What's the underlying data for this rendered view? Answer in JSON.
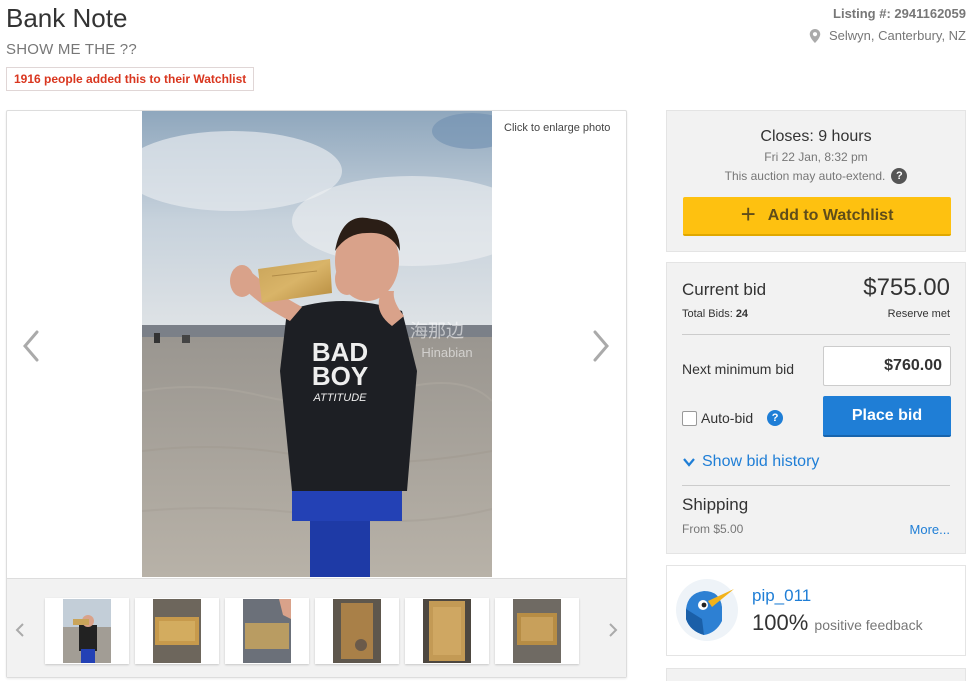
{
  "listing": {
    "title": "Bank Note",
    "subtitle": "SHOW ME THE ??",
    "watchlist_banner": "1916 people added this to their Watchlist",
    "listing_number": "Listing #: 2941162059",
    "location": "Selwyn, Canterbury, NZ"
  },
  "gallery": {
    "enlarge_hint": "Click to enlarge photo",
    "watermark_cn": "海那边",
    "watermark_en": "Hinabian",
    "shirt_line1": "BAD",
    "shirt_line2": "BOY",
    "shirt_line3": "ATTITUDE",
    "thumbnail_count": 6
  },
  "auction": {
    "closes": "Closes: 9 hours",
    "closes_date": "Fri 22 Jan, 8:32 pm",
    "auto_extend": "This auction may auto-extend.",
    "help_glyph": "?",
    "add_watchlist": "Add to Watchlist",
    "plus_glyph": "+"
  },
  "bid": {
    "current_label": "Current bid",
    "current_amount": "$755.00",
    "total_bids_label": "Total Bids:",
    "total_bids_count": "24",
    "reserve": "Reserve met",
    "next_min_label": "Next minimum bid",
    "next_min_value": "$760.00",
    "autobid_label": "Auto-bid",
    "place_bid": "Place bid",
    "show_history": "Show bid history"
  },
  "shipping": {
    "label": "Shipping",
    "from": "From $5.00",
    "more": "More..."
  },
  "seller": {
    "name": "pip_011",
    "percent": "100%",
    "feedback_text": "positive feedback"
  },
  "colors": {
    "accent_blue": "#1f7ed6",
    "watchlist_yellow": "#fec110",
    "banner_red": "#d9361f"
  }
}
